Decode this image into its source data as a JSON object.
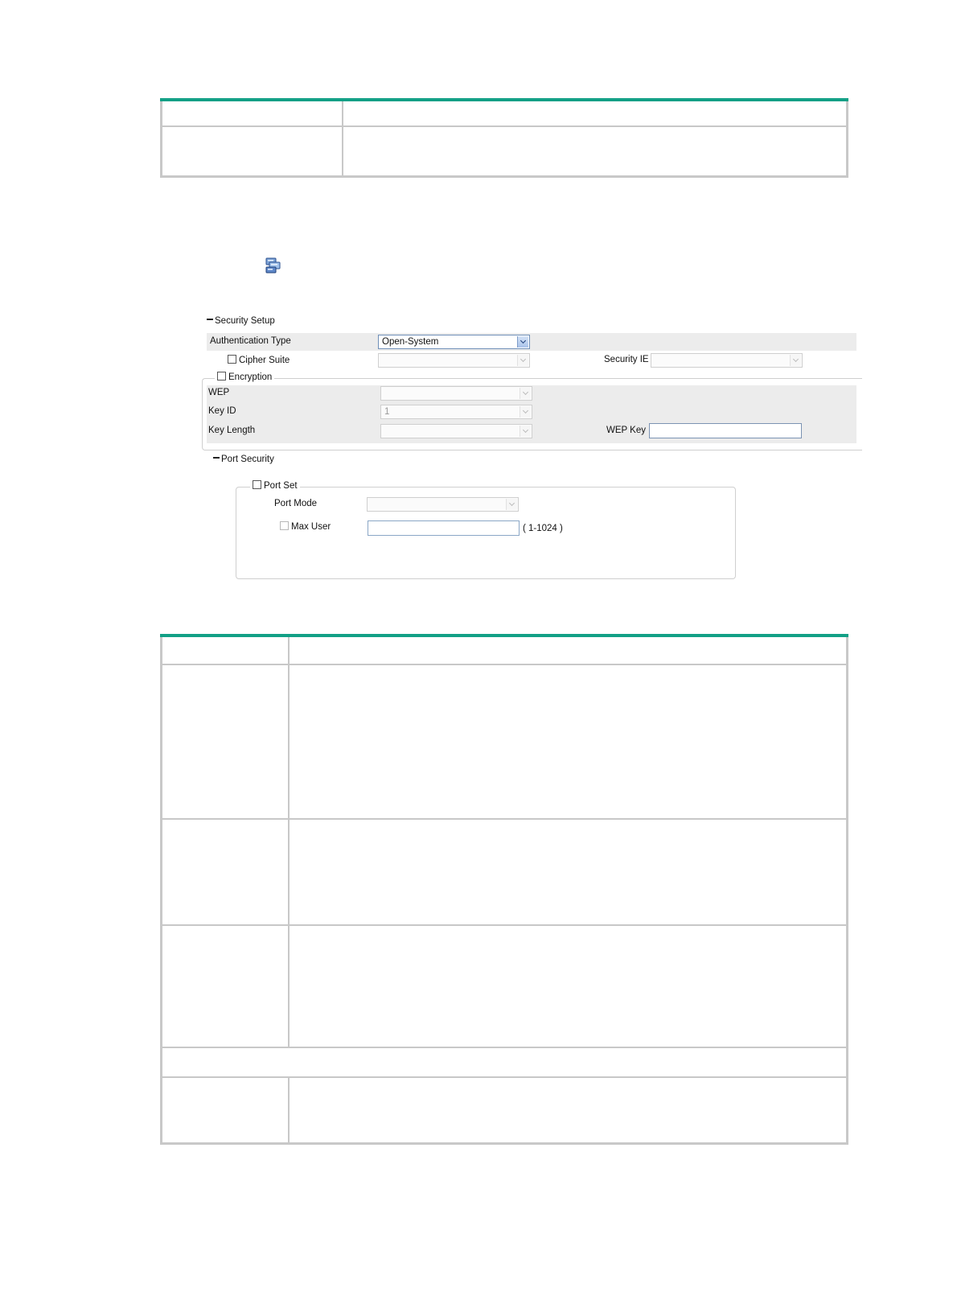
{
  "table1": {
    "rows": 2
  },
  "icon": {
    "name": "device-config-icon"
  },
  "security_setup": {
    "title": "Security Setup",
    "authentication_type_label": "Authentication Type",
    "authentication_type_value": "Open-System",
    "cipher_suite_label": "Cipher Suite",
    "security_ie_label": "Security IE",
    "encryption_label": "Encryption",
    "wep_label": "WEP",
    "key_id_label": "Key ID",
    "key_id_value": "1",
    "key_length_label": "Key Length",
    "wep_key_label": "WEP Key"
  },
  "port_security": {
    "title": "Port Security",
    "port_set_label": "Port Set",
    "port_mode_label": "Port Mode",
    "max_user_label": "Max User",
    "max_user_range": "( 1-1024 )"
  },
  "table2": {
    "rows": 6
  },
  "colors": {
    "table_top_border": "#12a086",
    "table_border": "#c8c8c8",
    "band": "#ececec"
  }
}
